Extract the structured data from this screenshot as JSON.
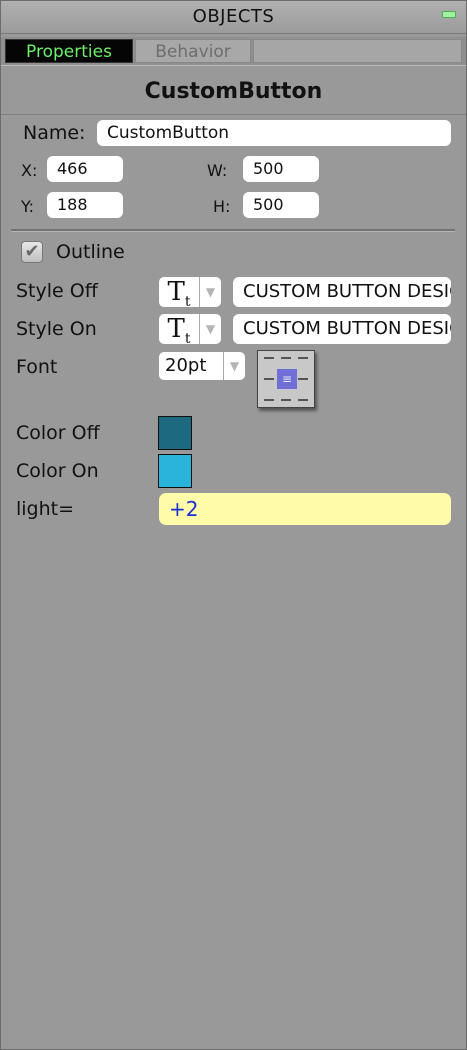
{
  "panel": {
    "title": "OBJECTS",
    "tabs": [
      {
        "label": "Properties",
        "active": true
      },
      {
        "label": "Behavior",
        "active": false
      }
    ],
    "object_name": "CustomButton"
  },
  "props": {
    "name_label": "Name:",
    "name_value": "CustomButton",
    "x_label": "X:",
    "x_value": "466",
    "y_label": "Y:",
    "y_value": "188",
    "w_label": "W:",
    "w_value": "500",
    "h_label": "H:",
    "h_value": "500",
    "outline_label": "Outline",
    "outline_checked": true,
    "style_off_label": "Style Off",
    "style_off_value": "CUSTOM BUTTON DESIGN",
    "style_on_label": "Style On",
    "style_on_value": "CUSTOM BUTTON DESIGN",
    "style_icon_glyph": "T",
    "style_icon_sub": "t",
    "font_label": "Font",
    "font_size": "20pt",
    "color_off_label": "Color Off",
    "color_off": "#1d6a80",
    "color_on_label": "Color On",
    "color_on": "#2ab4dc",
    "light_label": "light=",
    "light_value": "+2"
  },
  "icons": {
    "check": "✔",
    "dropdown": "▼",
    "align": "≡"
  },
  "colors": {
    "tab_active_text": "#6cf06c",
    "light_field_bg": "#fffba8",
    "light_field_text": "#1b2fd6"
  }
}
